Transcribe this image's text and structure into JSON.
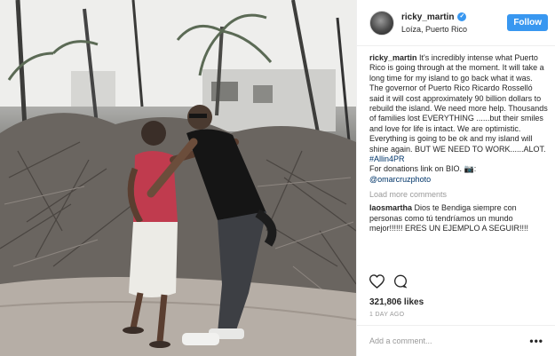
{
  "post": {
    "image_alt": "Photo of two people embracing among storm-damaged trees"
  },
  "header": {
    "username": "ricky_martin",
    "location": "Loíza, Puerto Rico",
    "follow_label": "Follow"
  },
  "caption": {
    "username": "ricky_martin",
    "text": "It's incredibly intense what Puerto Rico is going through at the moment. It will take a long time for my island to go back what it was. The governor of Puerto Rico Ricardo Rosselló said it will cost approximately 90 billion dollars to rebuild the island. We need more help. Thousands of families lost EVERYTHING ......but their smiles and love for life is intact. We are optimistic. Everything is going to be ok and my island will shine again. BUT WE NEED TO WORK......ALOT.",
    "hashtag": "#Allin4PR",
    "donations": "For donations link on BIO. 📷:",
    "mention": "@omarcruzphoto"
  },
  "comments": {
    "load_more": "Load more comments",
    "items": [
      {
        "username": "laosmartha",
        "text": "Dios te Bendiga siempre con personas como tú tendríamos un mundo mejor!!!!!! ERES UN EJEMPLO A SEGUIR!!!!"
      }
    ]
  },
  "stats": {
    "likes": "321,806 likes",
    "date": "1 DAY AGO"
  },
  "composer": {
    "placeholder": "Add a comment...",
    "more": "•••"
  },
  "colors": {
    "accent": "#3897f0",
    "link": "#003569",
    "muted": "#999999"
  }
}
